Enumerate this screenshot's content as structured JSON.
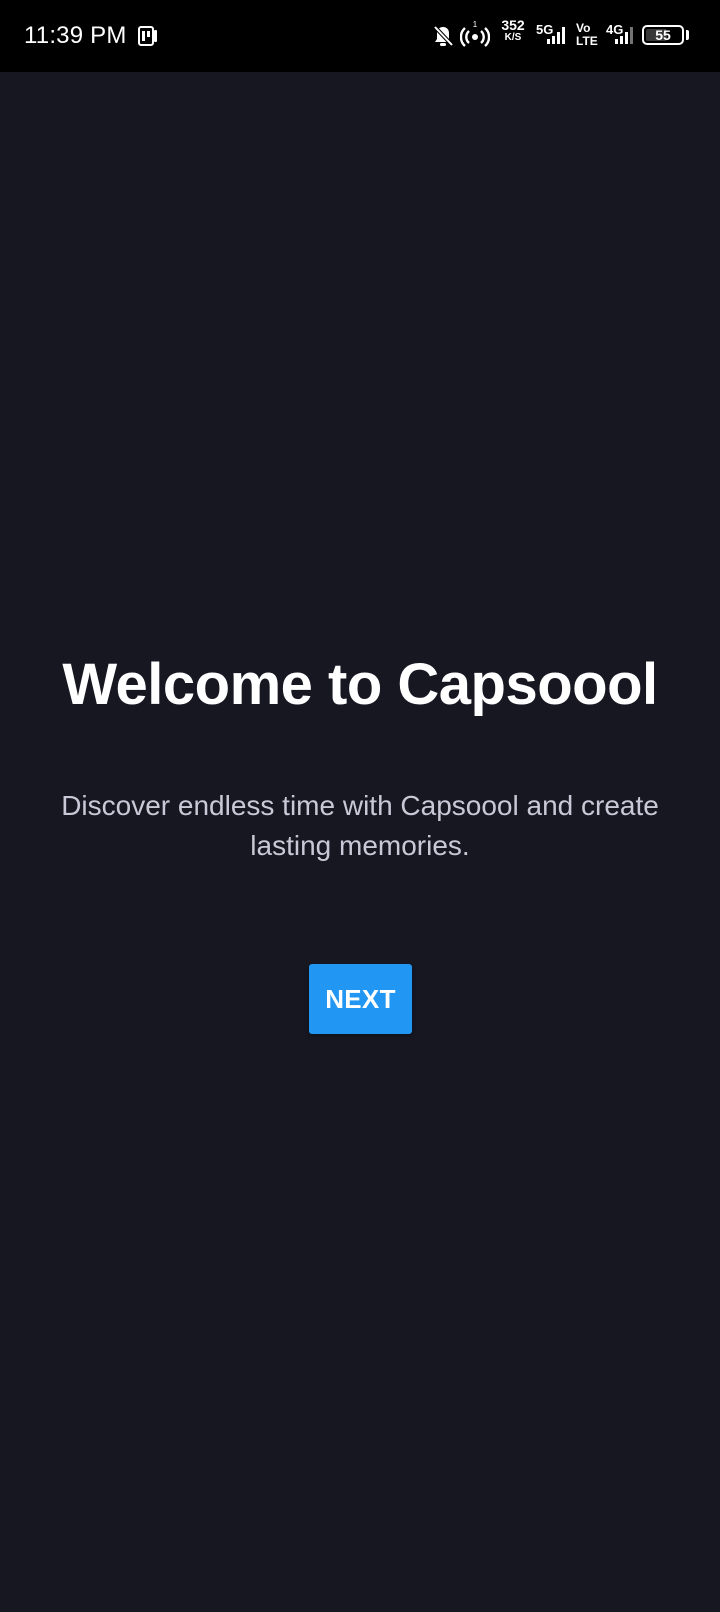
{
  "status_bar": {
    "time": "11:39 PM",
    "network_speed_value": "352",
    "network_speed_unit": "K/S",
    "network_5g_label": "5G",
    "volte_label_top": "Vo",
    "volte_label_bottom": "LTE",
    "network_4g_label": "4G",
    "battery_level": "55",
    "icons": [
      "app-notification-icon",
      "bell-off-icon",
      "hotspot-icon",
      "signal-icon",
      "signal-icon",
      "battery-icon"
    ]
  },
  "onboarding": {
    "title": "Welcome to Capsoool",
    "subtitle": "Discover endless time with Capsoool and create lasting memories.",
    "next_label": "NEXT"
  },
  "colors": {
    "background": "#171722",
    "status_bar": "#000000",
    "accent": "#2196f3",
    "title": "#ffffff",
    "subtitle": "#c9c8d6"
  }
}
